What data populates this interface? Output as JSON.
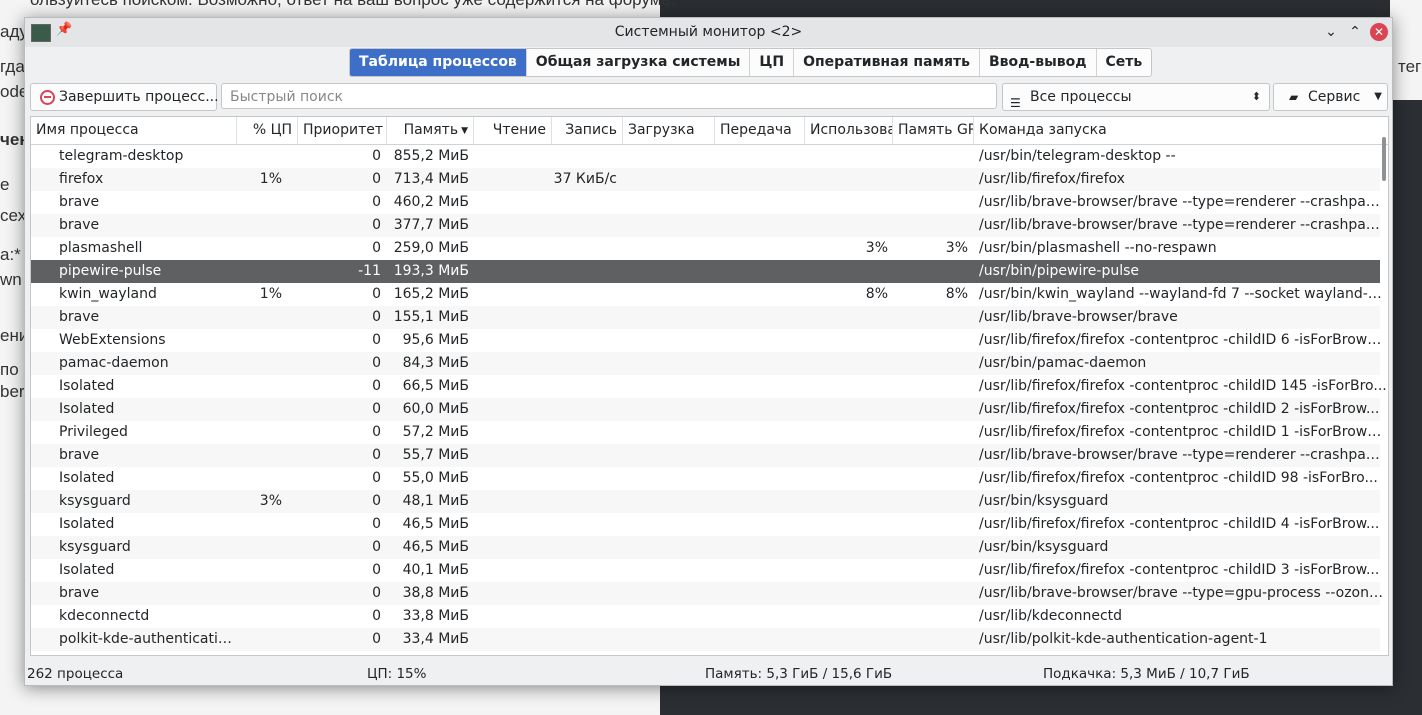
{
  "window": {
    "title": "Системный монитор <2>",
    "controls": {
      "minimize": "⌄",
      "maximize": "⌃",
      "close": "✕"
    }
  },
  "tabs": [
    {
      "label": "Таблица процессов",
      "active": true
    },
    {
      "label": "Общая загрузка системы",
      "active": false
    },
    {
      "label": "ЦП",
      "active": false
    },
    {
      "label": "Оперативная память",
      "active": false
    },
    {
      "label": "Ввод-вывод",
      "active": false
    },
    {
      "label": "Сеть",
      "active": false
    }
  ],
  "toolbar": {
    "kill_label": "Завершить процесс...",
    "search_placeholder": "Быстрый поиск",
    "filter_value": "Все процессы",
    "service_label": "Сервис"
  },
  "columns": {
    "name": "Имя процесса",
    "cpu": "% ЦП",
    "priority": "Приоритет",
    "memory": "Память",
    "read": "Чтение",
    "write": "Запись",
    "download": "Загрузка",
    "upload": "Передача",
    "gpu_usage": "Использова",
    "gpu_mem": "Память GPU",
    "command": "Команда запуска"
  },
  "rows": [
    {
      "name": "telegram-desktop",
      "cpu": "",
      "priority": "0",
      "memory": "855,2 МиБ",
      "write": "",
      "gpu": "",
      "gpumem": "",
      "cmd": "/usr/bin/telegram-desktop --",
      "selected": false
    },
    {
      "name": "firefox",
      "cpu": "1%",
      "priority": "0",
      "memory": "713,4 МиБ",
      "write": "37 КиБ/с",
      "gpu": "",
      "gpumem": "",
      "cmd": "/usr/lib/firefox/firefox",
      "selected": false
    },
    {
      "name": "brave",
      "cpu": "",
      "priority": "0",
      "memory": "460,2 МиБ",
      "write": "",
      "gpu": "",
      "gpumem": "",
      "cmd": "/usr/lib/brave-browser/brave --type=renderer --crashpad...",
      "selected": false
    },
    {
      "name": "brave",
      "cpu": "",
      "priority": "0",
      "memory": "377,7 МиБ",
      "write": "",
      "gpu": "",
      "gpumem": "",
      "cmd": "/usr/lib/brave-browser/brave --type=renderer --crashpad...",
      "selected": false
    },
    {
      "name": "plasmashell",
      "cpu": "",
      "priority": "0",
      "memory": "259,0 МиБ",
      "write": "",
      "gpu": "3%",
      "gpumem": "3%",
      "cmd": "/usr/bin/plasmashell --no-respawn",
      "selected": false
    },
    {
      "name": "pipewire-pulse",
      "cpu": "",
      "priority": "-11",
      "memory": "193,3 МиБ",
      "write": "",
      "gpu": "",
      "gpumem": "",
      "cmd": "/usr/bin/pipewire-pulse",
      "selected": true
    },
    {
      "name": "kwin_wayland",
      "cpu": "1%",
      "priority": "0",
      "memory": "165,2 МиБ",
      "write": "",
      "gpu": "8%",
      "gpumem": "8%",
      "cmd": "/usr/bin/kwin_wayland --wayland-fd 7 --socket wayland-0...",
      "selected": false
    },
    {
      "name": "brave",
      "cpu": "",
      "priority": "0",
      "memory": "155,1 МиБ",
      "write": "",
      "gpu": "",
      "gpumem": "",
      "cmd": "/usr/lib/brave-browser/brave",
      "selected": false
    },
    {
      "name": "WebExtensions",
      "cpu": "",
      "priority": "0",
      "memory": "95,6 МиБ",
      "write": "",
      "gpu": "",
      "gpumem": "",
      "cmd": "/usr/lib/firefox/firefox -contentproc -childID 6 -isForBrows...",
      "selected": false
    },
    {
      "name": "pamac-daemon",
      "cpu": "",
      "priority": "0",
      "memory": "84,3 МиБ",
      "write": "",
      "gpu": "",
      "gpumem": "",
      "cmd": "/usr/bin/pamac-daemon",
      "selected": false
    },
    {
      "name": "Isolated",
      "cpu": "",
      "priority": "0",
      "memory": "66,5 МиБ",
      "write": "",
      "gpu": "",
      "gpumem": "",
      "cmd": "/usr/lib/firefox/firefox -contentproc -childID 145 -isForBro...",
      "selected": false
    },
    {
      "name": "Isolated",
      "cpu": "",
      "priority": "0",
      "memory": "60,0 МиБ",
      "write": "",
      "gpu": "",
      "gpumem": "",
      "cmd": "/usr/lib/firefox/firefox -contentproc -childID 2 -isForBrow...",
      "selected": false
    },
    {
      "name": "Privileged",
      "cpu": "",
      "priority": "0",
      "memory": "57,2 МиБ",
      "write": "",
      "gpu": "",
      "gpumem": "",
      "cmd": "/usr/lib/firefox/firefox -contentproc -childID 1 -isForBrows...",
      "selected": false
    },
    {
      "name": "brave",
      "cpu": "",
      "priority": "0",
      "memory": "55,7 МиБ",
      "write": "",
      "gpu": "",
      "gpumem": "",
      "cmd": "/usr/lib/brave-browser/brave --type=renderer --crashpad...",
      "selected": false
    },
    {
      "name": "Isolated",
      "cpu": "",
      "priority": "0",
      "memory": "55,0 МиБ",
      "write": "",
      "gpu": "",
      "gpumem": "",
      "cmd": "/usr/lib/firefox/firefox -contentproc -childID 98 -isForBro...",
      "selected": false
    },
    {
      "name": "ksysguard",
      "cpu": "3%",
      "priority": "0",
      "memory": "48,1 МиБ",
      "write": "",
      "gpu": "",
      "gpumem": "",
      "cmd": "/usr/bin/ksysguard",
      "selected": false
    },
    {
      "name": "Isolated",
      "cpu": "",
      "priority": "0",
      "memory": "46,5 МиБ",
      "write": "",
      "gpu": "",
      "gpumem": "",
      "cmd": "/usr/lib/firefox/firefox -contentproc -childID 4 -isForBrow...",
      "selected": false
    },
    {
      "name": "ksysguard",
      "cpu": "",
      "priority": "0",
      "memory": "46,5 МиБ",
      "write": "",
      "gpu": "",
      "gpumem": "",
      "cmd": "/usr/bin/ksysguard",
      "selected": false
    },
    {
      "name": "Isolated",
      "cpu": "",
      "priority": "0",
      "memory": "40,1 МиБ",
      "write": "",
      "gpu": "",
      "gpumem": "",
      "cmd": "/usr/lib/firefox/firefox -contentproc -childID 3 -isForBrow...",
      "selected": false
    },
    {
      "name": "brave",
      "cpu": "",
      "priority": "0",
      "memory": "38,8 МиБ",
      "write": "",
      "gpu": "",
      "gpumem": "",
      "cmd": "/usr/lib/brave-browser/brave --type=gpu-process --ozone...",
      "selected": false
    },
    {
      "name": "kdeconnectd",
      "cpu": "",
      "priority": "0",
      "memory": "33,8 МиБ",
      "write": "",
      "gpu": "",
      "gpumem": "",
      "cmd": "/usr/lib/kdeconnectd",
      "selected": false
    },
    {
      "name": "polkit-kde-authenticatio...",
      "cpu": "",
      "priority": "0",
      "memory": "33,4 МиБ",
      "write": "",
      "gpu": "",
      "gpumem": "",
      "cmd": "/usr/lib/polkit-kde-authentication-agent-1",
      "selected": false
    }
  ],
  "status": {
    "processes": "262 процесса",
    "cpu": "ЦП: 15%",
    "memory": "Память: 5,3 ГиБ / 15,6 ГиБ",
    "swap": "Подкачка: 5,3 МиБ / 10,7 ГиБ"
  },
  "background": {
    "fragments": [
      "ользуйтесь поиском. Возможно, ответ на ваш вопрос уже содержится на форуме.",
      "аду",
      "гда",
      "ode",
      "чен",
      "е",
      "сех",
      "а:*",
      "wn",
      "ени",
      "по",
      "ber",
      "тег"
    ]
  },
  "colors": {
    "accent": "#3d6fc9",
    "selected_row": "#5f6061",
    "close": "#da4453"
  }
}
